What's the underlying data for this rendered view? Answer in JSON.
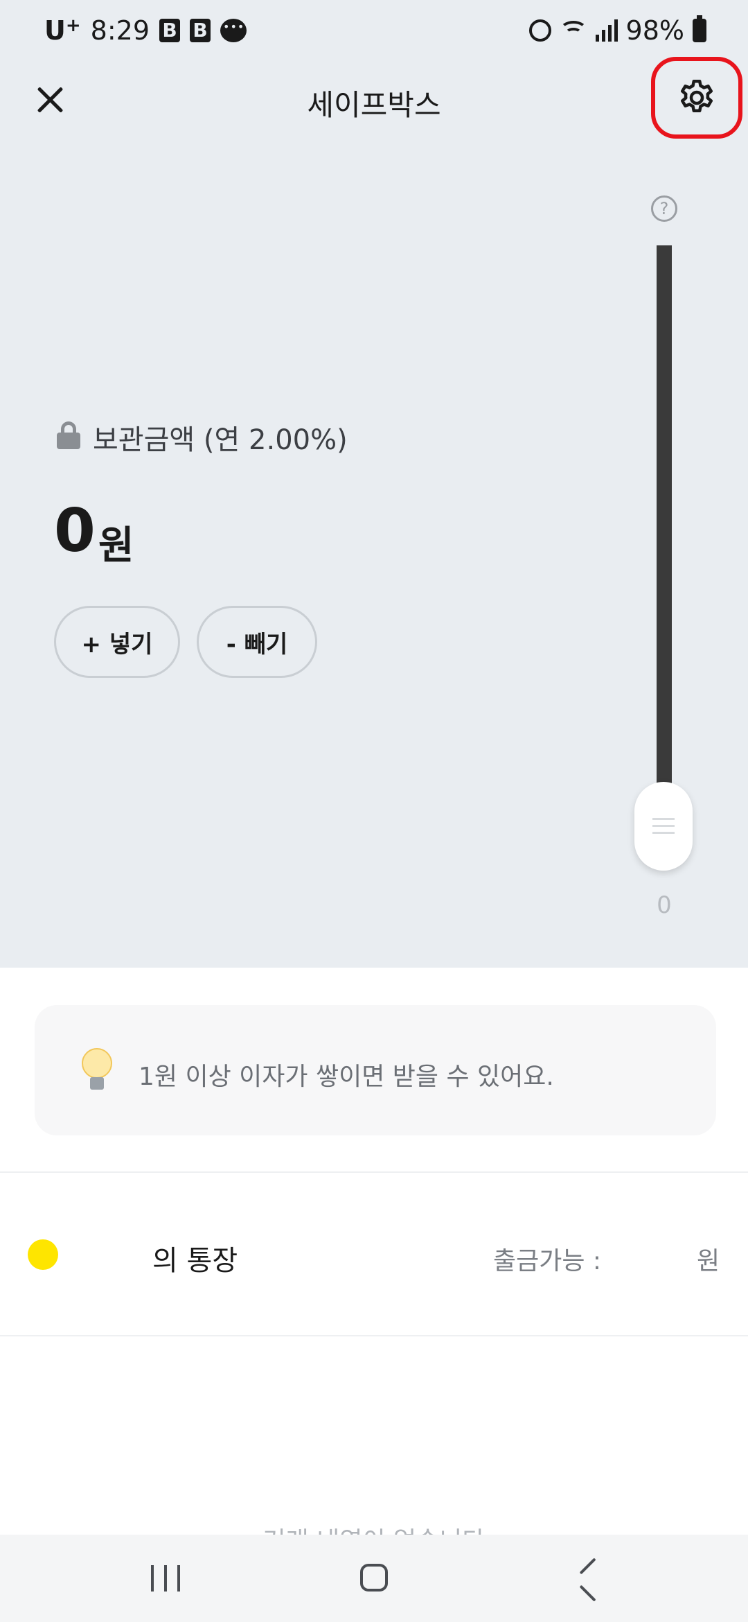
{
  "status_bar": {
    "carrier": "U",
    "carrier_suffix": "+",
    "time": "8:29",
    "battery": "98%",
    "app_icon_label": "B",
    "icons": [
      "b-app-icon",
      "b-app-icon",
      "chat-icon",
      "alarm-icon",
      "wifi-icon",
      "signal-icon",
      "battery-icon"
    ]
  },
  "header": {
    "title": "세이프박스",
    "close_icon": "close-icon",
    "settings_icon": "gear-icon"
  },
  "slider": {
    "help_label": "?",
    "value": "0"
  },
  "balance": {
    "label": "보관금액 (연 2.00%)",
    "amount": "0",
    "unit": "원"
  },
  "actions": {
    "deposit_label": "+ 넣기",
    "withdraw_label": "- 빼기"
  },
  "tip": {
    "icon": "lightbulb-icon",
    "text": "1원 이상 이자가 쌓이면 받을 수 있어요."
  },
  "account": {
    "name": "의 통장",
    "withdrawable_label": "출금가능 :",
    "withdrawable_unit": "원",
    "dot_color": "#fee500"
  },
  "footer": {
    "partial_text": "거래 내역이 없습니다"
  },
  "colors": {
    "highlight": "#e8141c",
    "background_top": "#e9edf1"
  }
}
